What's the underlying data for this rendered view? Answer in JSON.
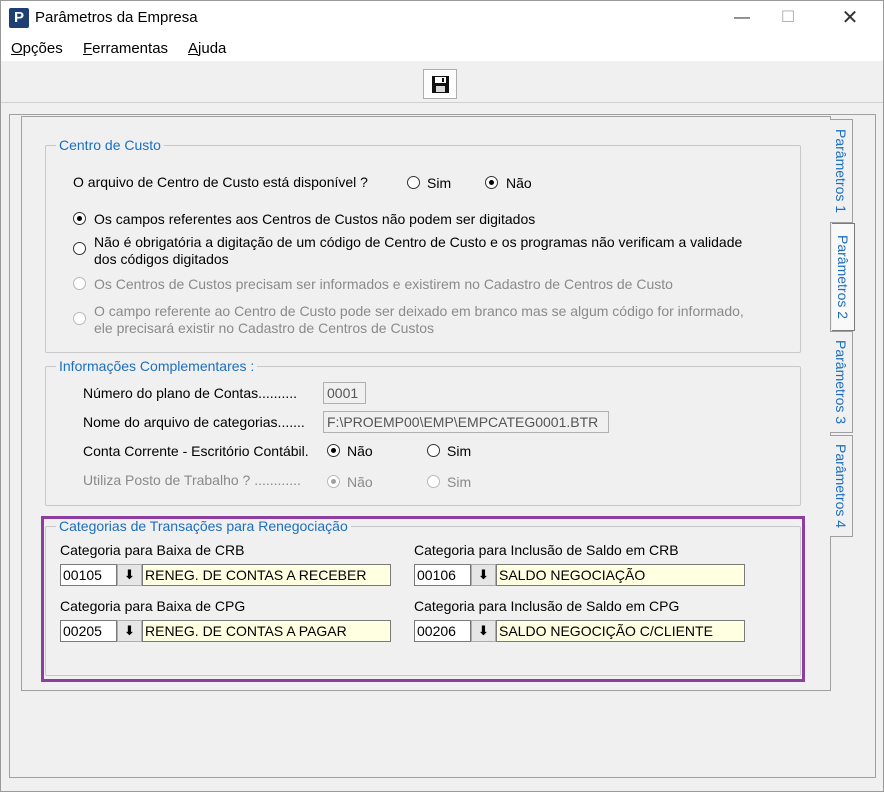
{
  "window": {
    "title": "Parâmetros da Empresa"
  },
  "menu": [
    {
      "prefix": "",
      "key": "O",
      "rest": "pções"
    },
    {
      "prefix": "",
      "key": "F",
      "rest": "erramentas"
    },
    {
      "prefix": "",
      "key": "A",
      "rest": "juda"
    }
  ],
  "toolbar": {
    "save_icon": "floppy-disk-icon"
  },
  "tabs": [
    "Parâmetros 1",
    "Parâmetros 2",
    "Parâmetros 3",
    "Parâmetros 4"
  ],
  "centro_custo": {
    "title": "Centro de Custo",
    "question": "O arquivo de  Centro de Custo  está disponível ?",
    "sim": "Sim",
    "nao": "Não",
    "opt1": "Os campos referentes aos Centros de Custos não podem ser digitados",
    "opt2_l1": "Não é obrigatória a digitação de um código de Centro de Custo e os programas não verificam a validade",
    "opt2_l2": "dos códigos digitados",
    "opt3": "Os Centros de Custos precisam ser informados e existirem no Cadastro de Centros de Custo",
    "opt4_l1": "O campo referente ao Centro de Custo pode ser deixado em branco mas se algum código for informado,",
    "opt4_l2": "ele precisará existir no Cadastro de Centros de Custos"
  },
  "info": {
    "title": "Informações Complementares :",
    "plano_label": "Número do plano de Contas..........",
    "plano_value": "0001",
    "arquivo_label": "Nome do arquivo de categorias.......",
    "arquivo_value": "F:\\PROEMP00\\EMP\\EMPCATEG0001.BTR",
    "conta_label": "Conta Corrente - Escritório Contábil.",
    "nao": "Não",
    "sim": "Sim",
    "posto_label": "Utiliza Posto de Trabalho ? ............"
  },
  "categorias": {
    "title": "Categorias de Transações para Renegociação",
    "baixa_crb_label": "Categoria para Baixa de CRB",
    "baixa_crb_code": "00105",
    "baixa_crb_desc": "RENEG. DE CONTAS A RECEBER",
    "incl_crb_label": "Categoria para Inclusão de Saldo em CRB",
    "incl_crb_code": "00106",
    "incl_crb_desc": "SALDO NEGOCIAÇÃO",
    "baixa_cpg_label": "Categoria para Baixa de CPG",
    "baixa_cpg_code": "00205",
    "baixa_cpg_desc": "RENEG. DE CONTAS A PAGAR",
    "incl_cpg_label": "Categoria para Inclusão de Saldo em CPG",
    "incl_cpg_code": "00206",
    "incl_cpg_desc": "SALDO NEGOCIÇÃO C/CLIENTE"
  },
  "glyphs": {
    "lookup": "⬇",
    "minimize": "—",
    "maximize": "☐",
    "close": "✕"
  }
}
